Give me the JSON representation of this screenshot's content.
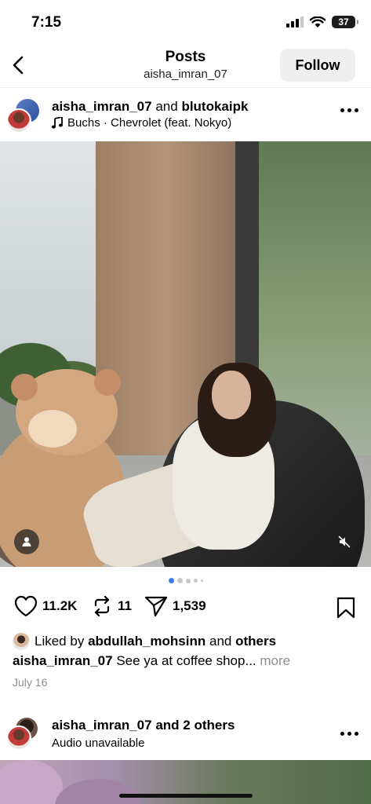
{
  "status": {
    "time": "7:15",
    "battery": "37"
  },
  "nav": {
    "title": "Posts",
    "subtitle": "aisha_imran_07",
    "follow_label": "Follow"
  },
  "post": {
    "user1": "aisha_imran_07",
    "joiner": "and",
    "user2": "blutokaipk",
    "audio": "Buchs · Chevrolet (feat. Nokyo)",
    "carousel": {
      "count": 5,
      "active": 0
    },
    "likes": "11.2K",
    "reposts": "11",
    "shares": "1,539",
    "liked_prefix": "Liked by",
    "liked_user": "abdullah_mohsinn",
    "liked_and": "and",
    "liked_others": "others",
    "caption_user": "aisha_imran_07",
    "caption_text": "See ya at coffee shop...",
    "caption_more": "more",
    "date": "July 16"
  },
  "post2": {
    "user": "aisha_imran_07",
    "others": "and 2 others",
    "sub": "Audio unavailable"
  },
  "icons": {
    "back": "chevron-left-icon",
    "heart": "heart-icon",
    "repost": "repost-icon",
    "share": "paper-plane-icon",
    "save": "bookmark-icon",
    "music": "music-note-icon",
    "tag": "person-tag-icon",
    "mute": "speaker-muted-icon"
  }
}
